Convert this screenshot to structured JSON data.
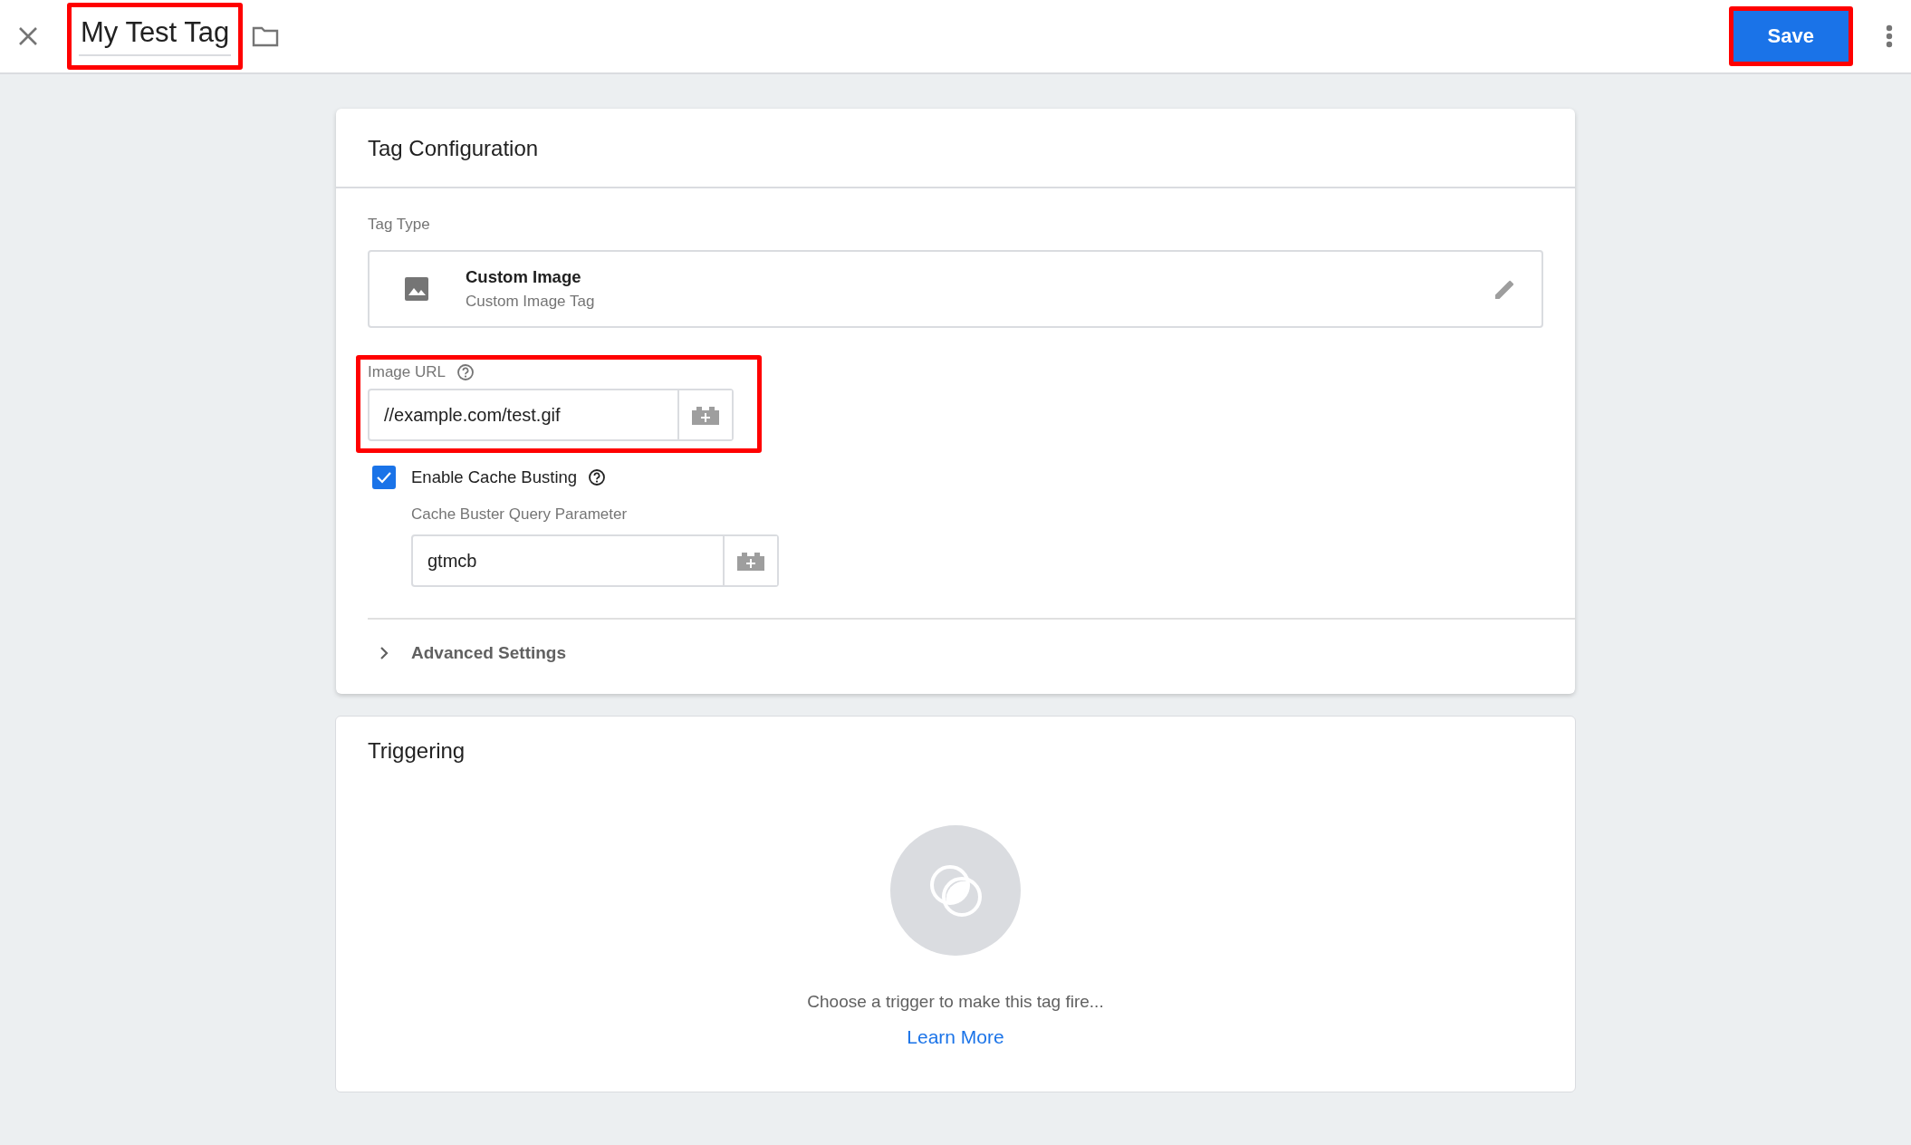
{
  "header": {
    "title": "My Test Tag",
    "title_highlighted": true,
    "save_button": {
      "label": "Save",
      "highlighted": true
    }
  },
  "tag_configuration": {
    "title": "Tag Configuration",
    "tag_type_label": "Tag Type",
    "tag_type": {
      "name": "Custom Image",
      "description": "Custom Image Tag"
    },
    "image_url": {
      "label": "Image URL",
      "value": "//example.com/test.gif",
      "highlighted": true
    },
    "cache_busting": {
      "label": "Enable Cache Busting",
      "checked": true,
      "parameter_label": "Cache Buster Query Parameter",
      "parameter_value": "gtmcb"
    },
    "advanced_settings": {
      "label": "Advanced Settings",
      "expanded": false
    }
  },
  "triggering": {
    "title": "Triggering",
    "empty_message": "Choose a trigger to make this tag fire...",
    "link": "Learn More"
  }
}
